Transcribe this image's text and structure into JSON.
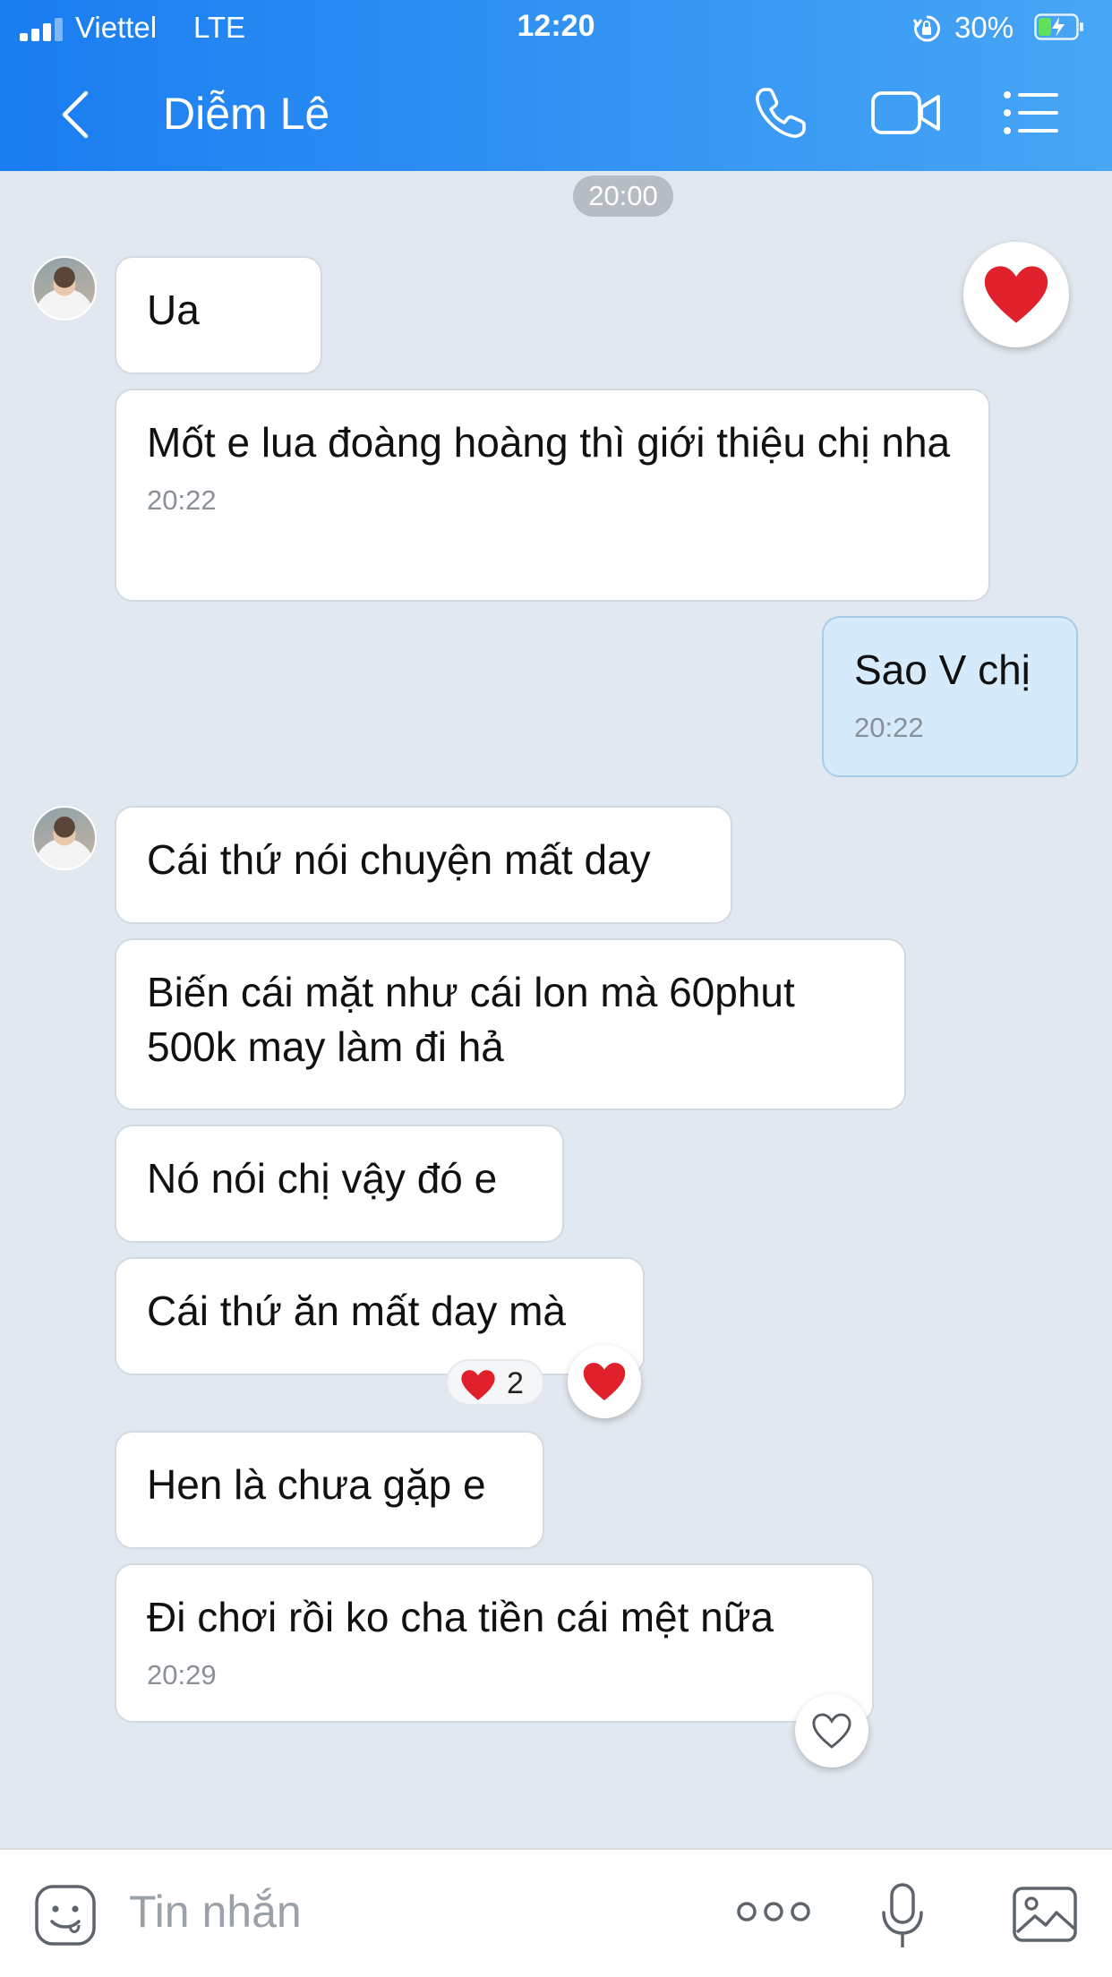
{
  "status_bar": {
    "carrier": "Viettel",
    "network": "LTE",
    "time": "12:20",
    "battery": "30%"
  },
  "header": {
    "contact_name": "Diễm Lê",
    "icons": [
      "back-icon",
      "phone-icon",
      "video-call-icon",
      "menu-icon"
    ]
  },
  "chat": {
    "date_pill": "20:00",
    "messages": [
      {
        "side": "received",
        "text": "Ua",
        "time": ""
      },
      {
        "side": "received",
        "text": "Mốt e lua đoàng hoàng thì giới thiệu chị nha",
        "time": "20:22"
      },
      {
        "side": "sent",
        "text": "Sao V chị",
        "time": "20:22"
      },
      {
        "side": "received",
        "text": "Cái thứ nói chuyện mất day",
        "time": ""
      },
      {
        "side": "received",
        "text": "Biến cái mặt như cái lon mà 60phut 500k may làm đi hả",
        "time": ""
      },
      {
        "side": "received",
        "text": "Nó nói chị vậy đó e",
        "time": ""
      },
      {
        "side": "received",
        "text": "Cái thứ ăn mất day mà",
        "time": "",
        "reaction_count": "2"
      },
      {
        "side": "received",
        "text": "Hen là chưa gặp e",
        "time": ""
      },
      {
        "side": "received",
        "text": "Đi chơi rồi ko cha tiền cái mệt nữa",
        "time": "20:29"
      }
    ]
  },
  "input": {
    "placeholder": "Tin nhắn",
    "icons": [
      "sticker-icon",
      "more-icon",
      "microphone-icon",
      "image-icon"
    ]
  },
  "colors": {
    "header_gradient_start": "#1a7df0",
    "header_gradient_end": "#48a6f5",
    "chat_background": "#e2e8ef",
    "sent_bubble": "#d5eafb",
    "received_bubble": "#ffffff",
    "reaction_heart": "#e0202a"
  }
}
